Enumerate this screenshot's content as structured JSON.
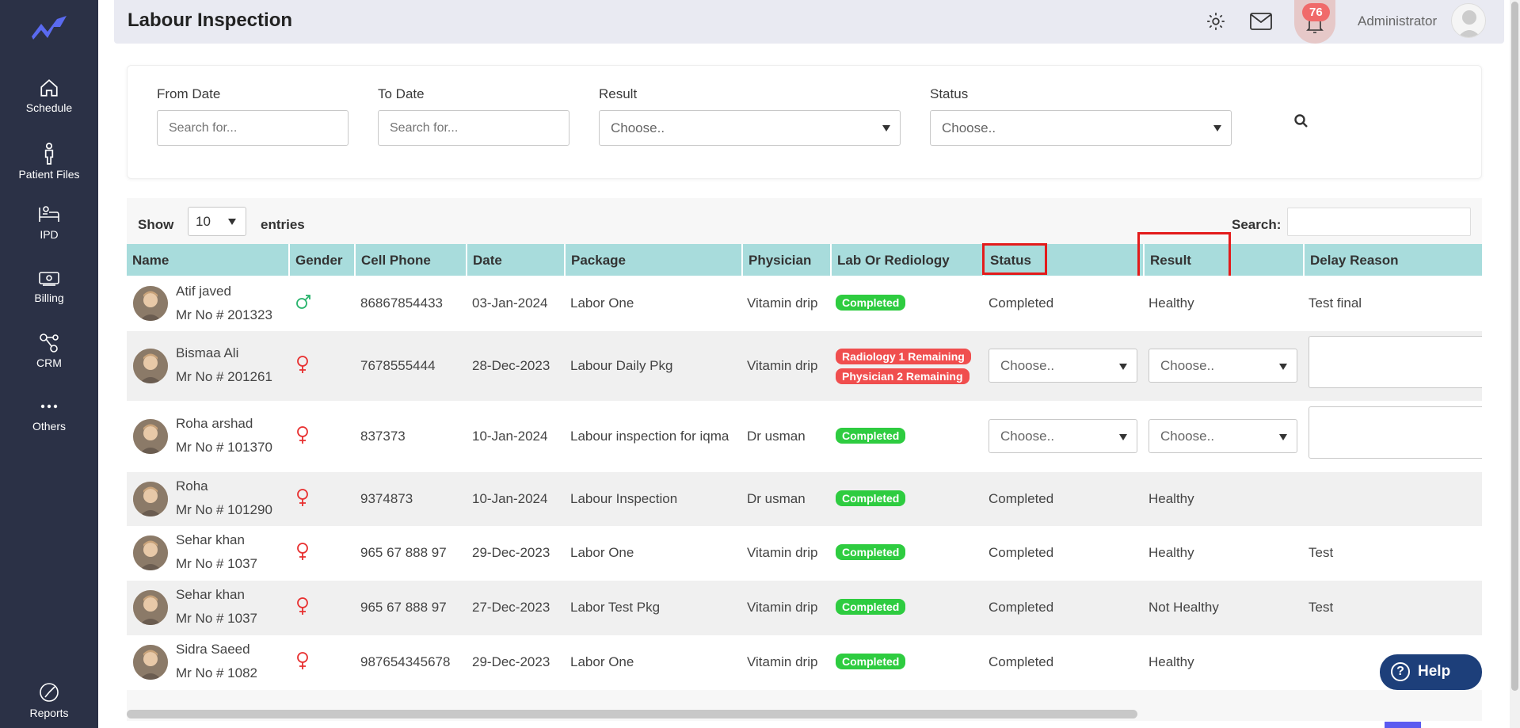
{
  "sidebar": {
    "items": [
      {
        "label": "Schedule",
        "icon": "home-icon"
      },
      {
        "label": "Patient Files",
        "icon": "person-icon"
      },
      {
        "label": "IPD",
        "icon": "bed-icon"
      },
      {
        "label": "Billing",
        "icon": "cash-icon"
      },
      {
        "label": "CRM",
        "icon": "network-icon"
      },
      {
        "label": "Others",
        "icon": "more-dots-icon"
      }
    ],
    "bottom": {
      "label": "Reports",
      "icon": "pie-chart-icon"
    }
  },
  "header": {
    "title": "Labour Inspection",
    "notification_count": "76",
    "user_name": "Administrator"
  },
  "filters": {
    "from_date": {
      "label": "From Date",
      "placeholder": "Search for..."
    },
    "to_date": {
      "label": "To Date",
      "placeholder": "Search for..."
    },
    "result": {
      "label": "Result",
      "value": "Choose.."
    },
    "status": {
      "label": "Status",
      "value": "Choose.."
    }
  },
  "table_controls": {
    "show_label": "Show",
    "entries_value": "10",
    "entries_label": "entries",
    "search_label": "Search:"
  },
  "columns": [
    "Name",
    "Gender",
    "Cell Phone",
    "Date",
    "Package",
    "Physician",
    "Lab Or Rediology",
    "Status",
    "Result",
    "Delay Reason"
  ],
  "rows": [
    {
      "name": "Atif javed",
      "mrno": "Mr No # 201323",
      "gender": "male",
      "phone": "86867854433",
      "date": "03-Jan-2024",
      "package": "Labor One",
      "physician": "Vitamin drip",
      "lab": [
        "Completed"
      ],
      "status": "Completed",
      "result": "Healthy",
      "delay": "Test final"
    },
    {
      "name": "Bismaa Ali",
      "mrno": "Mr No # 201261",
      "gender": "female",
      "phone": "7678555444",
      "date": "28-Dec-2023",
      "package": "Labour Daily Pkg",
      "physician": "Vitamin drip",
      "lab": [
        "Radiology 1 Remaining",
        "Physician 2 Remaining"
      ],
      "status": "Choose..",
      "result": "Choose..",
      "delay": ""
    },
    {
      "name": "Roha arshad",
      "mrno": "Mr No # 101370",
      "gender": "female",
      "phone": "837373",
      "date": "10-Jan-2024",
      "package": "Labour inspection for iqma",
      "physician": "Dr usman",
      "lab": [
        "Completed"
      ],
      "status": "Choose..",
      "result": "Choose..",
      "delay": ""
    },
    {
      "name": "Roha",
      "mrno": "Mr No # 101290",
      "gender": "female",
      "phone": "9374873",
      "date": "10-Jan-2024",
      "package": "Labour Inspection",
      "physician": "Dr usman",
      "lab": [
        "Completed"
      ],
      "status": "Completed",
      "result": "Healthy",
      "delay": ""
    },
    {
      "name": "Sehar khan",
      "mrno": "Mr No # 1037",
      "gender": "female",
      "phone": "965 67 888 97",
      "date": "29-Dec-2023",
      "package": "Labor One",
      "physician": "Vitamin drip",
      "lab": [
        "Completed"
      ],
      "status": "Completed",
      "result": "Healthy",
      "delay": "Test"
    },
    {
      "name": "Sehar khan",
      "mrno": "Mr No # 1037",
      "gender": "female",
      "phone": "965 67 888 97",
      "date": "27-Dec-2023",
      "package": "Labor Test Pkg",
      "physician": "Vitamin drip",
      "lab": [
        "Completed"
      ],
      "status": "Completed",
      "result": "Not Healthy",
      "delay": "Test"
    },
    {
      "name": "Sidra Saeed",
      "mrno": "Mr No # 1082",
      "gender": "female",
      "phone": "987654345678",
      "date": "29-Dec-2023",
      "package": "Labor One",
      "physician": "Vitamin drip",
      "lab": [
        "Completed"
      ],
      "status": "Completed",
      "result": "Healthy",
      "delay": ""
    }
  ],
  "help": {
    "label": "Help"
  },
  "colors": {
    "sidebar": "#2b3146",
    "table_header": "#a8dcdc",
    "pill_green": "#2ecc40",
    "pill_red": "#f04e4e",
    "highlight_box": "#e31b1b",
    "help_button": "#1d3f7a"
  }
}
